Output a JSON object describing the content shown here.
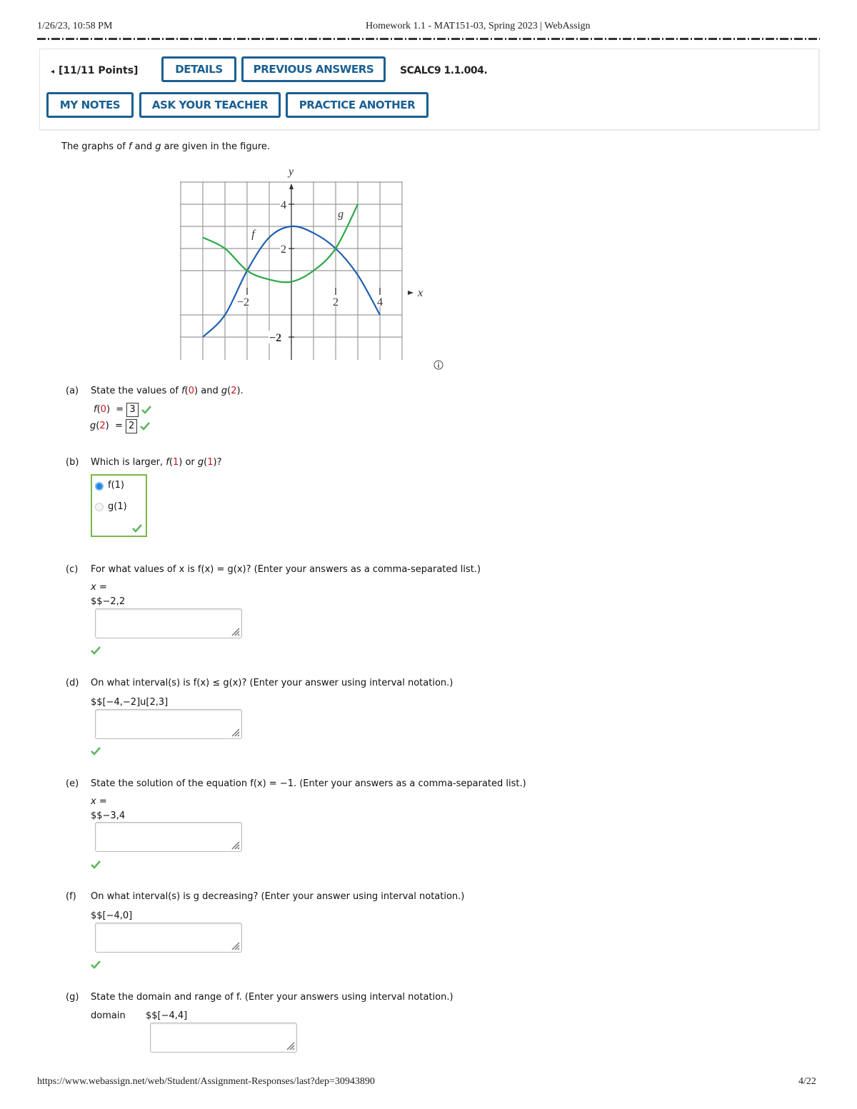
{
  "page_header": {
    "datetime": "1/26/23, 10:58 PM",
    "title": "Homework 1.1 - MAT151-03, Spring 2023 | WebAssign"
  },
  "question_header": {
    "points": "[11/11 Points]",
    "buttons": {
      "details": "DETAILS",
      "previous_answers": "PREVIOUS ANSWERS",
      "my_notes": "MY NOTES",
      "ask_teacher": "ASK YOUR TEACHER",
      "practice_another": "PRACTICE ANOTHER"
    },
    "question_code": "SCALC9 1.1.004."
  },
  "intro": {
    "pre": "The graphs of ",
    "f": "f",
    "mid": " and ",
    "g": "g",
    "post": " are given in the figure."
  },
  "chart_data": {
    "type": "line",
    "title": "",
    "xlabel": "x",
    "ylabel": "y",
    "xlim": [
      -5,
      5
    ],
    "ylim": [
      -3,
      5
    ],
    "grid": true,
    "x_tick_labels": [
      "−2",
      "2",
      "4"
    ],
    "y_tick_labels": [
      "4",
      "2",
      "−2"
    ],
    "annotations": [
      "f",
      "g"
    ],
    "series": [
      {
        "name": "f",
        "color": "#1f5fb0",
        "x": [
          -4,
          -3,
          -2,
          -1,
          0,
          1,
          2,
          3,
          4
        ],
        "y": [
          -2,
          -1,
          1,
          2.5,
          3,
          2.7,
          2,
          0.8,
          -1
        ]
      },
      {
        "name": "g",
        "color": "#2aa845",
        "x": [
          -4,
          -3,
          -2,
          -1,
          0,
          1,
          2,
          3
        ],
        "y": [
          2.5,
          2,
          1,
          0.6,
          0.5,
          1,
          2,
          4
        ]
      }
    ]
  },
  "parts": {
    "a": {
      "label": "(a)",
      "prompt_pre": "State the values of ",
      "prompt_f": "f",
      "prompt_fa": "(",
      "prompt_f0": "0",
      "prompt_fb": ")",
      "prompt_and": " and ",
      "prompt_g": "g",
      "prompt_ga": "(",
      "prompt_g2": "2",
      "prompt_gb": ").",
      "f0_answer": "3",
      "g2_answer": "2"
    },
    "b": {
      "label": "(b)",
      "prompt_pre": "Which is larger, ",
      "prompt_or": " or ",
      "prompt_end": "?",
      "options": [
        "f(1)",
        "g(1)"
      ],
      "selected": "f(1)"
    },
    "c": {
      "label": "(c)",
      "prompt": "For what values of x is f(x) = g(x)? (Enter your answers as a comma-separated list.)",
      "var_label": "x =",
      "answer": "$$−2,2"
    },
    "d": {
      "label": "(d)",
      "prompt": "On what interval(s) is f(x) ≤ g(x)? (Enter your answer using interval notation.)",
      "answer": "$$[−4,−2]u[2,3]"
    },
    "e": {
      "label": "(e)",
      "prompt": "State the solution of the equation f(x) = −1. (Enter your answers as a comma-separated list.)",
      "var_label": "x =",
      "answer": "$$−3,4"
    },
    "f": {
      "label": "(f)",
      "prompt": "On what interval(s) is g decreasing? (Enter your answer using interval notation.)",
      "answer": "$$[−4,0]"
    },
    "g": {
      "label": "(g)",
      "prompt": "State the domain and range of f. (Enter your answers using interval notation.)",
      "domain_label": "domain",
      "domain_answer": "$$[−4,4]"
    }
  },
  "page_footer": {
    "url": "https://www.webassign.net/web/Student/Assignment-Responses/last?dep=30943890",
    "page": "4/22"
  },
  "colors": {
    "button_blue": "#1a5f92",
    "correct_green": "#5cb85c",
    "red_arg": "#d0131b"
  }
}
